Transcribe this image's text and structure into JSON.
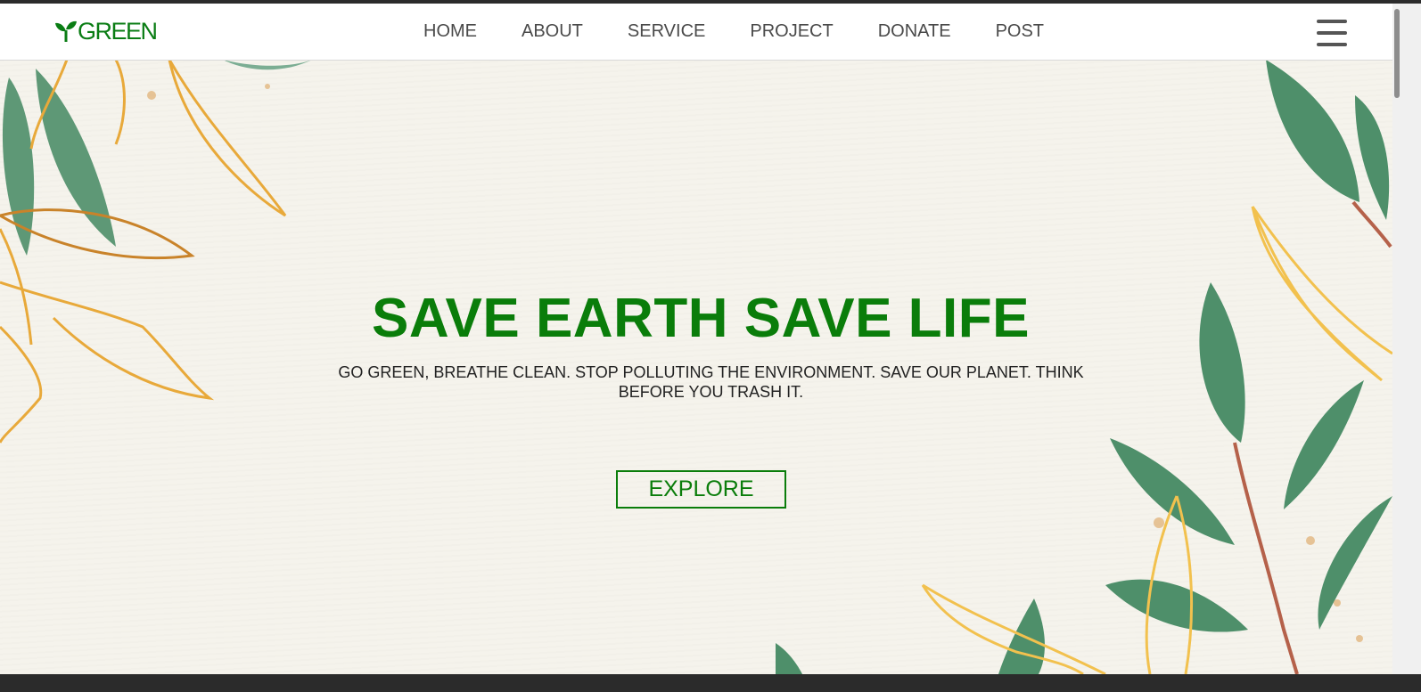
{
  "header": {
    "logo_text": "GREEN",
    "nav": [
      {
        "label": "HOME"
      },
      {
        "label": "ABOUT"
      },
      {
        "label": "SERVICE"
      },
      {
        "label": "PROJECT"
      },
      {
        "label": "DONATE"
      },
      {
        "label": "POST"
      }
    ],
    "menu_icon": "hamburger-menu-icon"
  },
  "hero": {
    "title": "SAVE EARTH SAVE LIFE",
    "subtitle": "GO GREEN, BREATHE CLEAN. STOP POLLUTING THE ENVIRONMENT. SAVE OUR PLANET. THINK BEFORE YOU TRASH IT.",
    "button_label": "EXPLORE"
  },
  "colors": {
    "brand_green": "#0a7d0a",
    "leaf_green": "#4e8f6a",
    "gold_outline": "#e8a93a",
    "background": "#f5f3ec"
  }
}
